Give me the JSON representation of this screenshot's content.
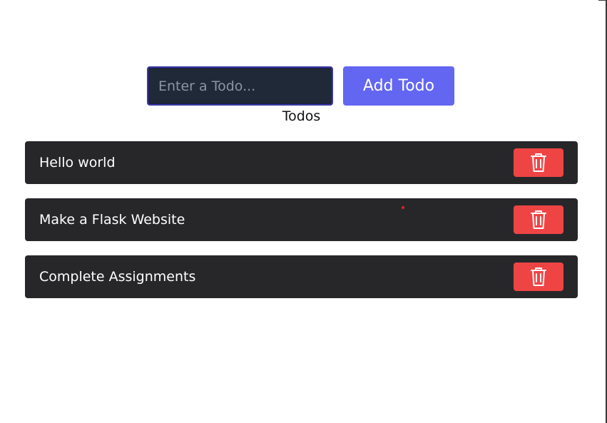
{
  "form": {
    "input_placeholder": "Enter a Todo...",
    "input_value": "",
    "add_button_label": "Add Todo"
  },
  "heading": "Todos",
  "todos": [
    {
      "text": "Hello world"
    },
    {
      "text": "Make a Flask Website"
    },
    {
      "text": "Complete Assignments"
    }
  ],
  "icons": {
    "delete": "trash-icon"
  },
  "colors": {
    "accent": "#6366f1",
    "danger": "#ef4444",
    "item_bg": "#27272a",
    "input_bg": "#1f2937"
  }
}
